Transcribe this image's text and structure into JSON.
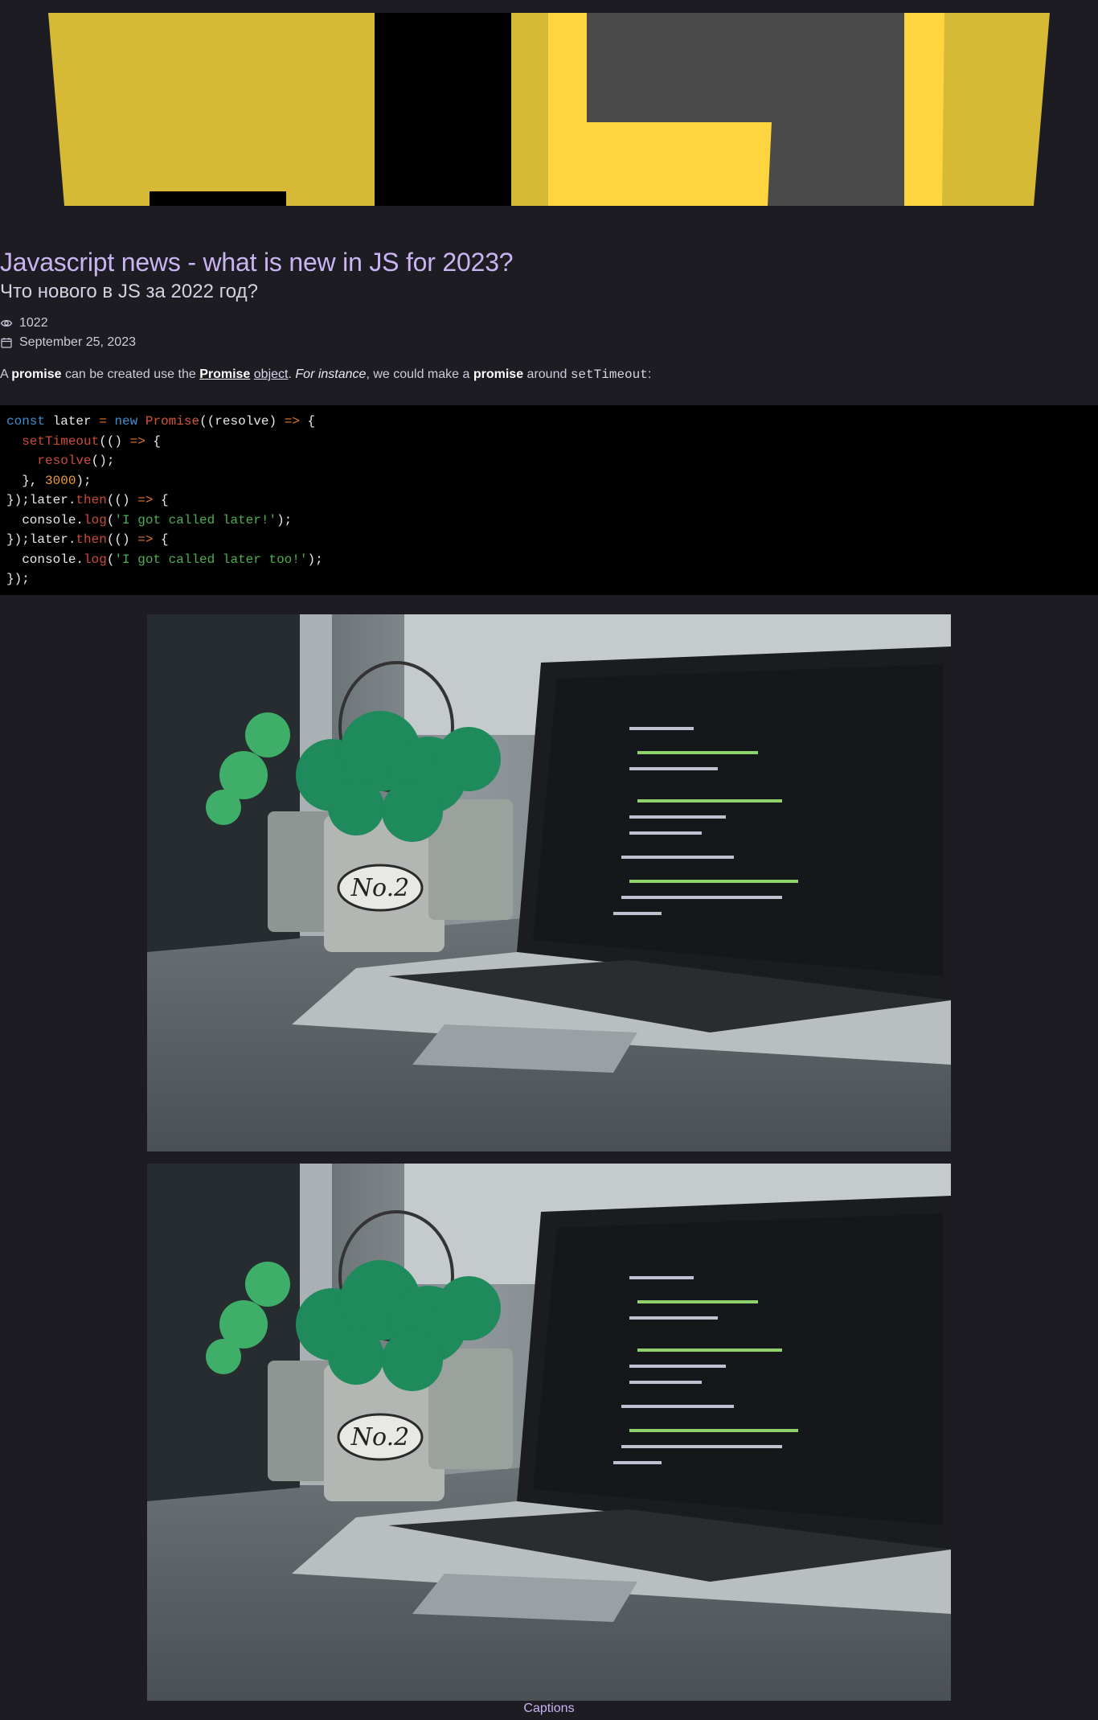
{
  "article": {
    "title": "Javascript news - what is new in JS for 2023?",
    "subtitle": "Что нового в JS за 2022 год?",
    "views": "1022",
    "date": "September 25, 2023"
  },
  "paragraph": {
    "a": "A",
    "promise_1": "promise",
    "can_be_created": "can be created use the",
    "promise_link": "Promise",
    "object_link": "object",
    "dot": ".",
    "for_instance": "For instance",
    "we_could": ", we could make a",
    "promise_2": "promise",
    "around": "around",
    "settimeout": "setTimeout",
    "colon": ":"
  },
  "code": {
    "language": "javascript",
    "lines": [
      "const later = new Promise((resolve) => {",
      "  setTimeout(() => {",
      "    resolve();",
      "  }, 3000);",
      "});later.then(() => {",
      "  console.log('I got called later!');",
      "});later.then(() => {",
      "  console.log('I got called later too!');",
      "});"
    ]
  },
  "images": {
    "hero": "js-logo-banner",
    "photo_1": "laptop-with-code-and-plants",
    "photo_2": "laptop-with-code-and-plants",
    "pot_label": "No.2"
  },
  "caption": "Captions",
  "icons": {
    "views": "eye-icon",
    "date": "calendar-icon"
  },
  "colors": {
    "background": "#1c1c22",
    "accent": "#c9b3f0",
    "js_yellow": "#f7d63a",
    "code_background": "#000000"
  }
}
